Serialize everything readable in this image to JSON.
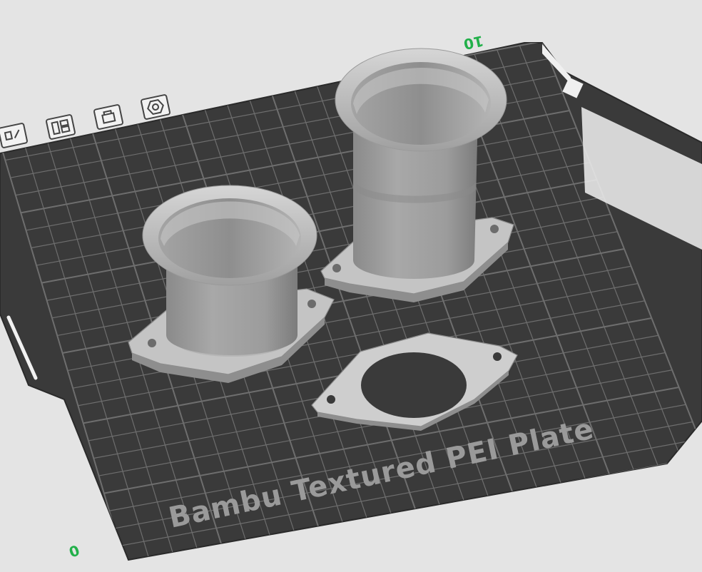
{
  "plate": {
    "label": "Bambu Textured PEI Plate",
    "bed_color": "#3a3a3a",
    "grid_color": "#6e6e6e",
    "background": "#e4e4e4"
  },
  "axes": {
    "origin_label": "0",
    "x_label": "10"
  },
  "plate_toolbar": [
    {
      "name": "arrange-icon"
    },
    {
      "name": "layout-icon"
    },
    {
      "name": "lock-icon"
    },
    {
      "name": "settings-nut-icon"
    }
  ],
  "objects": [
    {
      "name": "velocity-stack-short"
    },
    {
      "name": "velocity-stack-tall"
    },
    {
      "name": "flange-gasket"
    }
  ]
}
